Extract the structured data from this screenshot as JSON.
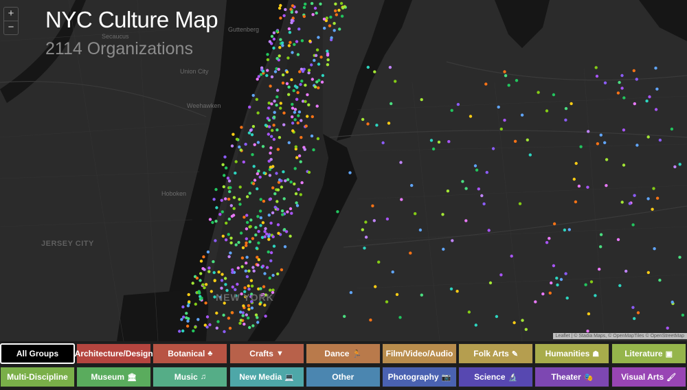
{
  "header": {
    "title": "NYC Culture Map",
    "subtitle": "2114 Organizations"
  },
  "zoom": {
    "in_label": "+",
    "out_label": "−"
  },
  "attribution": "Leaflet | © Stadia Maps, © OpenMapTiles © OpenStreetMap",
  "map_labels": [
    {
      "id": "secaucus",
      "text": "Secaucus"
    },
    {
      "id": "guttenberg",
      "text": "Guttenberg"
    },
    {
      "id": "union_city",
      "text": "Union City"
    },
    {
      "id": "weehawken",
      "text": "Weehawken"
    },
    {
      "id": "hoboken",
      "text": "Hoboken"
    },
    {
      "id": "jersey_city",
      "text": "JERSEY CITY"
    },
    {
      "id": "new_york",
      "text": "NEW YORK"
    }
  ],
  "categories": [
    {
      "label": "All Groups",
      "icon": "",
      "color": "#000000"
    },
    {
      "label": "Architecture/Design",
      "icon": "",
      "color": "#b5453f"
    },
    {
      "label": "Botanical",
      "icon": "tree-icon",
      "glyph": "♣",
      "color": "#b85444"
    },
    {
      "label": "Crafts",
      "icon": "crafts-icon",
      "glyph": "▼",
      "color": "#b8614a"
    },
    {
      "label": "Dance",
      "icon": "dance-icon",
      "glyph": "🏃",
      "color": "#b97a4b"
    },
    {
      "label": "Film/Video/Audio",
      "icon": "",
      "color": "#b98d4d"
    },
    {
      "label": "Folk Arts",
      "icon": "ruler-icon",
      "glyph": "✎",
      "color": "#b59e4f"
    },
    {
      "label": "Humanities",
      "icon": "humanities-icon",
      "glyph": "☗",
      "color": "#a8ac4b"
    },
    {
      "label": "Literature",
      "icon": "literature-icon",
      "glyph": "▣",
      "color": "#95b54b"
    },
    {
      "label": "Multi-Discipline",
      "icon": "",
      "color": "#7aaf49"
    },
    {
      "label": "Museum",
      "icon": "museum-icon",
      "glyph": "🏛",
      "color": "#5aac5d"
    },
    {
      "label": "Music",
      "icon": "music-icon",
      "glyph": "♫",
      "color": "#55ad87"
    },
    {
      "label": "New Media",
      "icon": "laptop-icon",
      "glyph": "💻",
      "color": "#4ea7a8"
    },
    {
      "label": "Other",
      "icon": "",
      "color": "#4b86b0"
    },
    {
      "label": "Photography",
      "icon": "camera-icon",
      "glyph": "📷",
      "color": "#4a62b1"
    },
    {
      "label": "Science",
      "icon": "microscope-icon",
      "glyph": "🔬",
      "color": "#5748b1"
    },
    {
      "label": "Theater",
      "icon": "theater-icon",
      "glyph": "🎭",
      "color": "#7d47b2"
    },
    {
      "label": "Visual Arts",
      "icon": "brush-icon",
      "glyph": "🖌",
      "color": "#9845b4"
    }
  ],
  "dot_colors": [
    "#a855f7",
    "#8b5cf6",
    "#4ade80",
    "#84cc16",
    "#2dd4bf",
    "#22c55e",
    "#c084fc",
    "#f97316",
    "#facc15",
    "#60a5fa",
    "#a3e635",
    "#e879f9"
  ]
}
